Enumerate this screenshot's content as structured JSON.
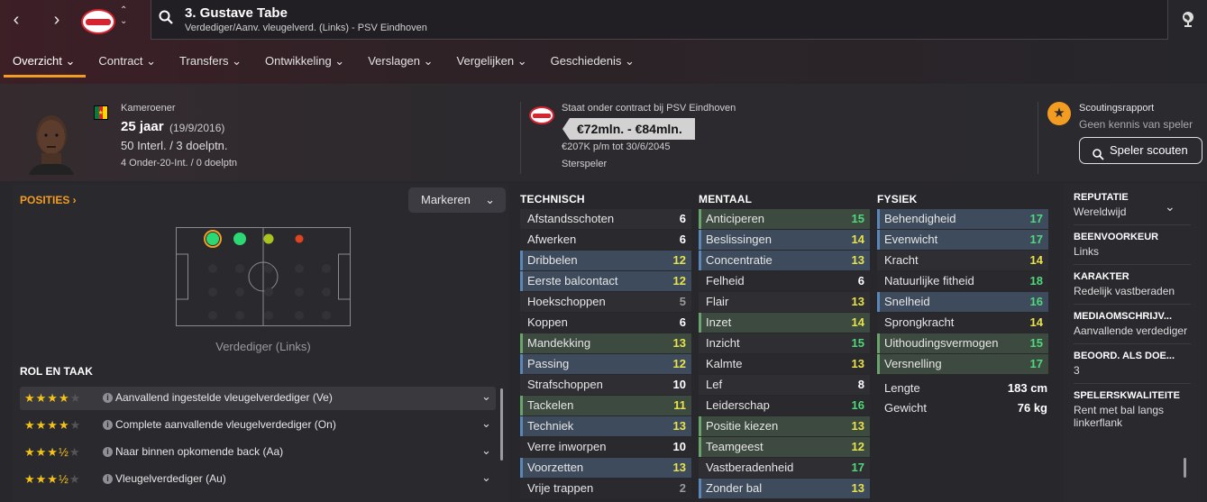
{
  "player": {
    "name": "3. Gustave Tabe",
    "subtitle": "Verdediger/Aanv. vleugelverd. (Links) - PSV Eindhoven"
  },
  "tabs": [
    {
      "label": "Overzicht ⌄"
    },
    {
      "label": "Contract ⌄"
    },
    {
      "label": "Transfers ⌄"
    },
    {
      "label": "Ontwikkeling ⌄"
    },
    {
      "label": "Verslagen ⌄"
    },
    {
      "label": "Vergelijken ⌄"
    },
    {
      "label": "Geschiedenis ⌄"
    }
  ],
  "bio": {
    "nationality": "Kameroener",
    "age": "25 jaar",
    "dob": "(19/9/2016)",
    "caps": "50 Interl. / 3 doelptn.",
    "u20": "4 Onder-20-Int. / 0 doelptn"
  },
  "contract": {
    "status": "Staat onder contract bij PSV Eindhoven",
    "value": "€72mln. - €84mln.",
    "wage": "€207K p/m tot 30/6/2045",
    "role": "Sterspeler"
  },
  "scout": {
    "title": "Scoutingsrapport",
    "text": "Geen kennis van speler",
    "button": "Speler scouten"
  },
  "positions": {
    "title": "POSITIES ›",
    "mark_button": "Markeren",
    "label": "Verdediger (Links)"
  },
  "roles": {
    "title": "ROL EN TAAK",
    "items": [
      {
        "stars": "★★★★",
        "empty": "★",
        "name": "Aanvallend ingestelde vleugelverdediger (Ve)"
      },
      {
        "stars": "★★★★",
        "empty": "★",
        "name": "Complete aanvallende vleugelverdediger (On)"
      },
      {
        "stars": "★★★½",
        "empty": "★",
        "name": "Naar binnen opkomende back (Aa)"
      },
      {
        "stars": "★★★½",
        "empty": "★",
        "name": "Vleugelverdediger (Au)"
      }
    ]
  },
  "technical": {
    "title": "TECHNISCH",
    "rows": [
      {
        "name": "Afstandsschoten",
        "value": "6"
      },
      {
        "name": "Afwerken",
        "value": "6"
      },
      {
        "name": "Dribbelen",
        "value": "12"
      },
      {
        "name": "Eerste balcontact",
        "value": "12"
      },
      {
        "name": "Hoekschoppen",
        "value": "5"
      },
      {
        "name": "Koppen",
        "value": "6"
      },
      {
        "name": "Mandekking",
        "value": "13"
      },
      {
        "name": "Passing",
        "value": "12"
      },
      {
        "name": "Strafschoppen",
        "value": "10"
      },
      {
        "name": "Tackelen",
        "value": "11"
      },
      {
        "name": "Techniek",
        "value": "13"
      },
      {
        "name": "Verre inworpen",
        "value": "10"
      },
      {
        "name": "Voorzetten",
        "value": "13"
      },
      {
        "name": "Vrije trappen",
        "value": "2"
      }
    ]
  },
  "mental": {
    "title": "MENTAAL",
    "rows": [
      {
        "name": "Anticiperen",
        "value": "15"
      },
      {
        "name": "Beslissingen",
        "value": "14"
      },
      {
        "name": "Concentratie",
        "value": "13"
      },
      {
        "name": "Felheid",
        "value": "6"
      },
      {
        "name": "Flair",
        "value": "13"
      },
      {
        "name": "Inzet",
        "value": "14"
      },
      {
        "name": "Inzicht",
        "value": "15"
      },
      {
        "name": "Kalmte",
        "value": "13"
      },
      {
        "name": "Lef",
        "value": "8"
      },
      {
        "name": "Leiderschap",
        "value": "16"
      },
      {
        "name": "Positie kiezen",
        "value": "13"
      },
      {
        "name": "Teamgeest",
        "value": "12"
      },
      {
        "name": "Vastberadenheid",
        "value": "17"
      },
      {
        "name": "Zonder bal",
        "value": "13"
      }
    ]
  },
  "physical": {
    "title": "FYSIEK",
    "rows": [
      {
        "name": "Behendigheid",
        "value": "17"
      },
      {
        "name": "Evenwicht",
        "value": "17"
      },
      {
        "name": "Kracht",
        "value": "14"
      },
      {
        "name": "Natuurlijke fitheid",
        "value": "18"
      },
      {
        "name": "Snelheid",
        "value": "16"
      },
      {
        "name": "Sprongkracht",
        "value": "14"
      },
      {
        "name": "Uithoudingsvermogen",
        "value": "15"
      },
      {
        "name": "Versnelling",
        "value": "17"
      }
    ],
    "height_label": "Lengte",
    "height": "183 cm",
    "weight_label": "Gewicht",
    "weight": "76 kg"
  },
  "info": [
    {
      "title": "REPUTATIE",
      "value": "Wereldwijd"
    },
    {
      "title": "BEENVOORKEUR",
      "value": "Links"
    },
    {
      "title": "KARAKTER",
      "value": "Redelijk vastberaden"
    },
    {
      "title": "MEDIAOMSCHRIJV...",
      "value": "Aanvallende verdediger"
    },
    {
      "title": "BEOORD. ALS DOE...",
      "value": "3"
    },
    {
      "title": "SPELERSKWALITEITE",
      "value": "Rent met bal langs linkerflank"
    }
  ],
  "colors": {
    "accent": "#f29c21",
    "high": "#4fd97a",
    "mid": "#e8e34a",
    "low": "#9a9a9a",
    "white": "#ffffff"
  }
}
